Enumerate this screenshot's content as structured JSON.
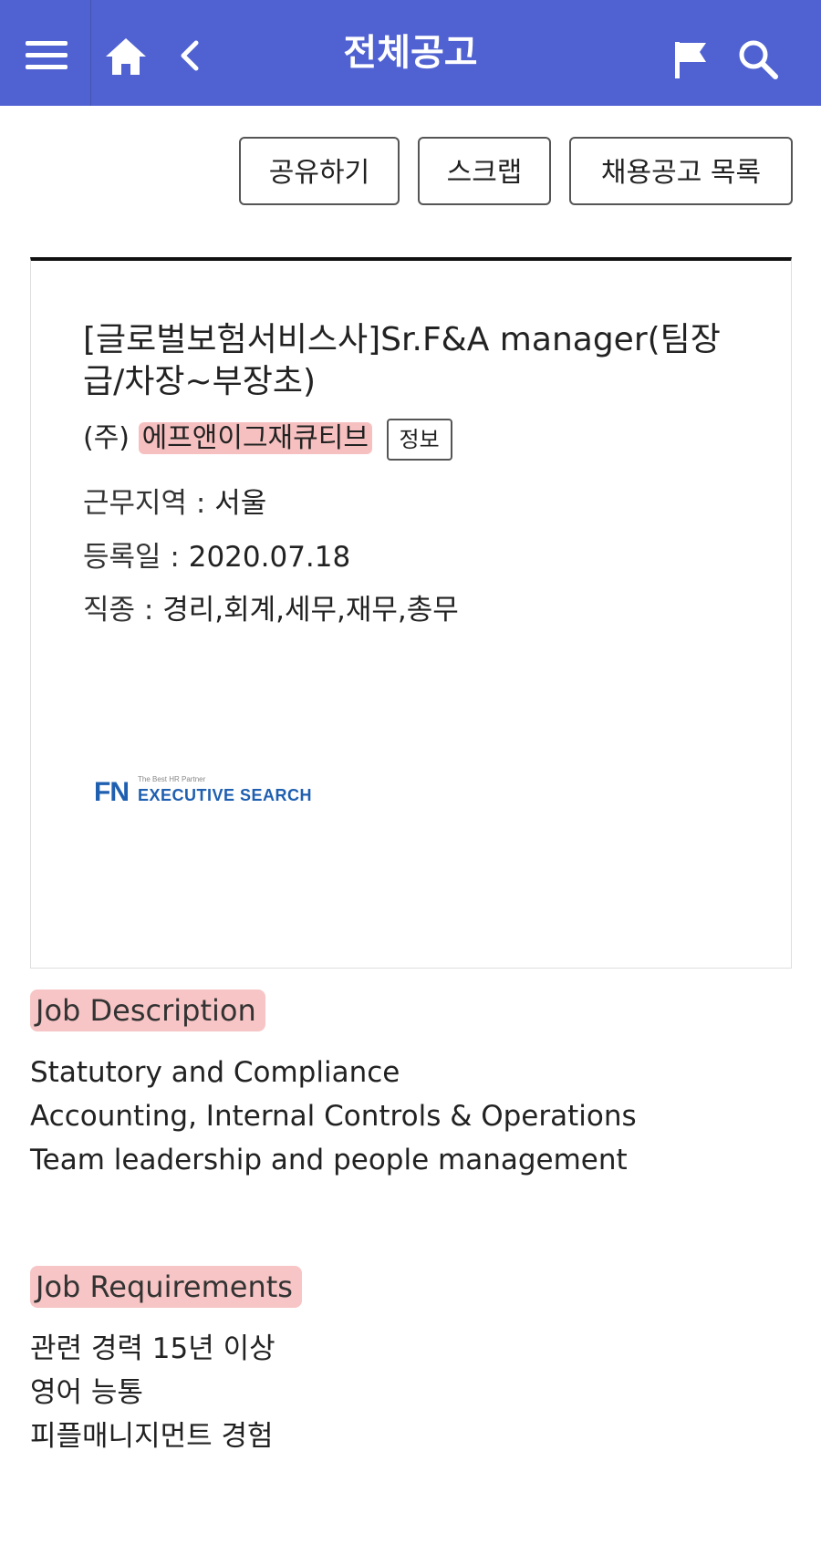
{
  "header": {
    "title": "전체공고",
    "background": "#5062d1",
    "icons": [
      "menu-icon",
      "home-icon",
      "back-icon",
      "flag-icon",
      "search-icon"
    ]
  },
  "actions": {
    "share": "공유하기",
    "scrap": "스크랩",
    "list": "채용공고 목록"
  },
  "posting": {
    "title": "[글로벌보험서비스사]Sr.F&A manager(팀장급/차장~부장초)",
    "company_prefix": "(주)",
    "company_name": "에프앤이그재큐티브",
    "info_button": "정보",
    "location_label": "근무지역 : ",
    "location_value": "서울",
    "date_label": "등록일 : ",
    "date_value": "2020.07.18",
    "job_type_label": "직종 : ",
    "job_type_value": "경리,회계,세무,재무,총무",
    "logo": {
      "mark": "FN",
      "tagline": "The Best HR Partner",
      "text": "EXECUTIVE SEARCH"
    }
  },
  "description": {
    "heading": "Job Description",
    "lines": [
      "Statutory and Compliance",
      "Accounting, Internal Controls & Operations",
      "Team leadership and people management"
    ]
  },
  "requirements": {
    "heading": "Job Requirements",
    "lines": [
      "관련 경력 15년 이상",
      "영어 능통",
      "피플매니지먼트 경험"
    ]
  }
}
